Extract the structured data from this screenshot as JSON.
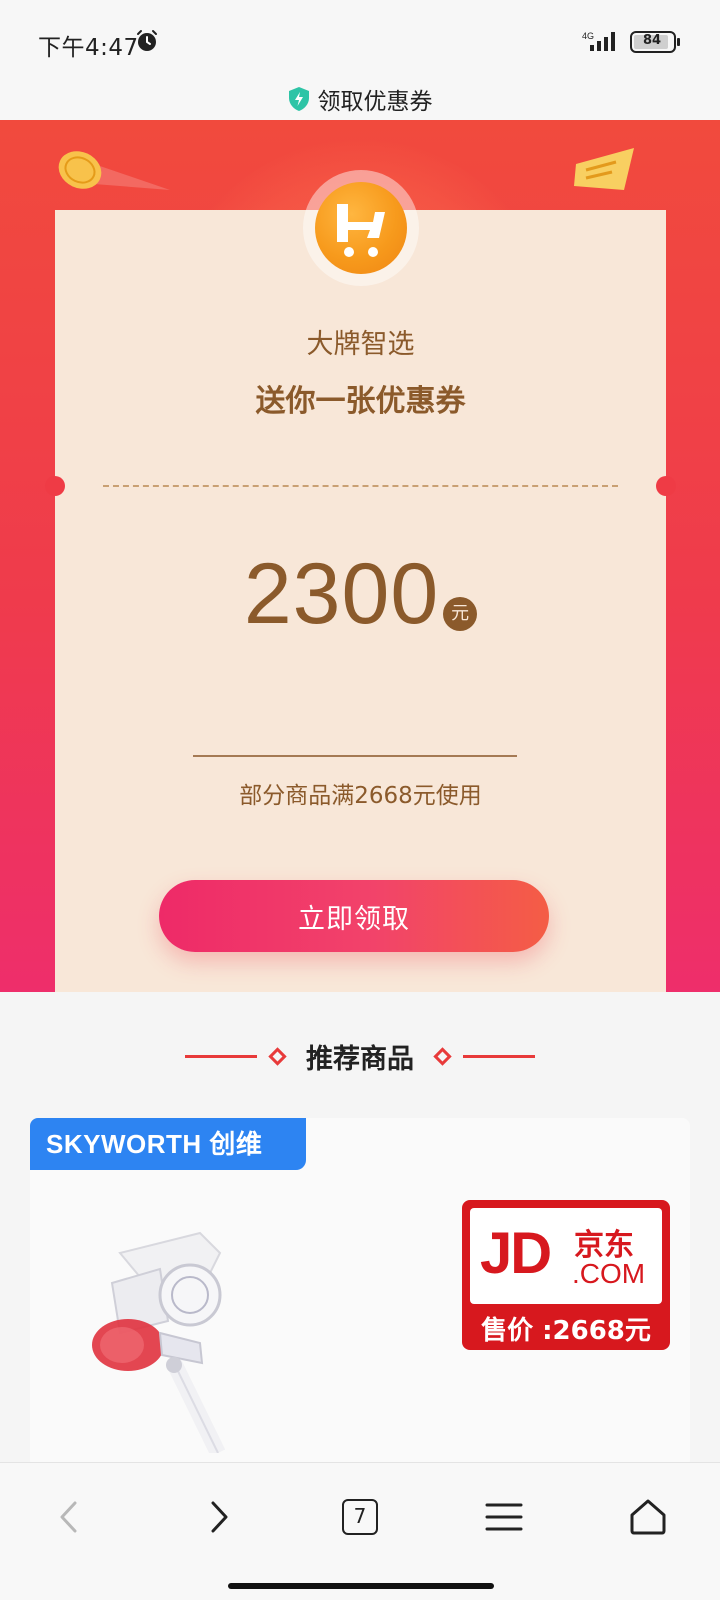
{
  "status_bar": {
    "time": "下午4:47",
    "network": "4G",
    "battery": "84"
  },
  "title_bar": {
    "title": "领取优惠券"
  },
  "coupon": {
    "brand_name": "大牌智选",
    "headline": "送你一张优惠券",
    "amount": "2300",
    "unit": "元",
    "condition": "部分商品满2668元使用",
    "claim_label": "立即领取"
  },
  "recommend": {
    "title": "推荐商品",
    "product": {
      "brand_tag": "SKYWORTH 创维",
      "store_logo_text": "JD",
      "store_logo_cn": "京东",
      "store_logo_com": ".COM",
      "price_text": "售价 :2668元"
    }
  },
  "bottom_nav": {
    "tabs_count": "7"
  },
  "icons": {
    "alarm": "alarm-icon",
    "signal": "signal-icon",
    "battery": "battery-icon",
    "shield": "shield-icon",
    "back": "back-arrow-icon",
    "forward": "forward-arrow-icon",
    "tabs": "tabs-icon",
    "menu": "menu-icon",
    "home": "home-icon"
  },
  "colors": {
    "hero_red": "#f14a3d",
    "coupon_bg": "#f8e7d8",
    "coupon_text": "#8b5a2b",
    "button_start": "#ee2a68",
    "button_end": "#f45d45",
    "accent_blue": "#2d84f2",
    "jd_red": "#d7181e"
  }
}
